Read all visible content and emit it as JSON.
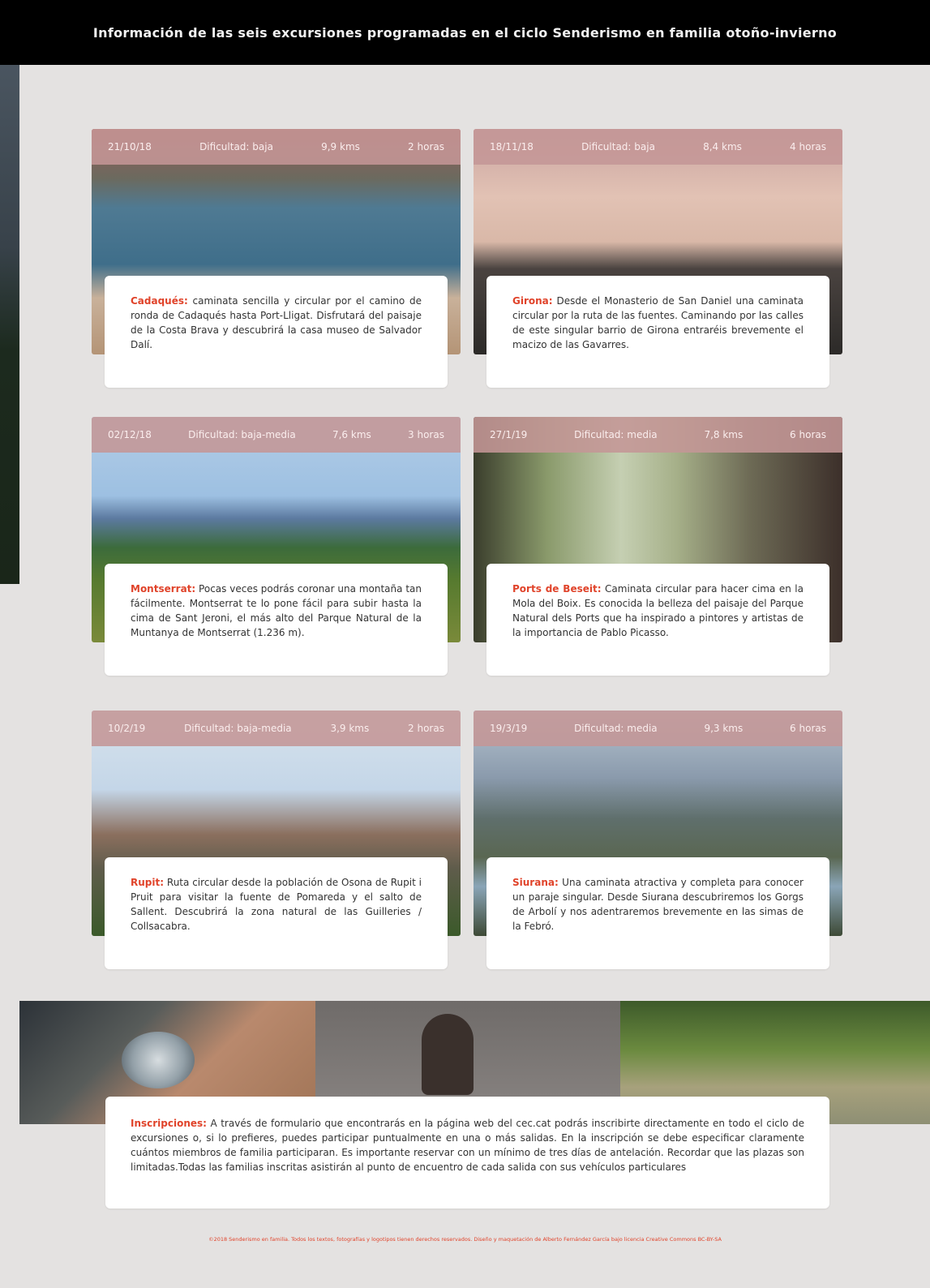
{
  "header": {
    "title": "Información de las seis excursiones programadas en el ciclo Senderismo en familia otoño-invierno"
  },
  "excursions": [
    {
      "date": "21/10/18",
      "difficulty": "Dificultad: baja",
      "distance": "9,9 kms",
      "duration": "2 horas",
      "place": "Cadaqués:",
      "description": " caminata sencilla y circular por el camino de ronda de Cadaqués hasta Port-Lligat. Disfrutará del paisaje de la Costa Brava y descubrirá la casa museo de Salvador Dalí."
    },
    {
      "date": "18/11/18",
      "difficulty": "Dificultad: baja",
      "distance": "8,4 kms",
      "duration": "4 horas",
      "place": "Girona:",
      "description": " Desde el Monasterio de San Daniel una caminata circular por la ruta de las fuentes. Caminando por las calles de este singular barrio de Girona entraréis brevemente el macizo de las Gavarres."
    },
    {
      "date": "02/12/18",
      "difficulty": "Dificultad: baja-media",
      "distance": "7,6 kms",
      "duration": "3 horas",
      "place": "Montserrat:",
      "description": " Pocas veces podrás coronar una montaña tan fácilmente. Montserrat te lo pone fácil para subir hasta la cima de Sant Jeroni, el más alto del Parque Natural de la Muntanya de Montserrat (1.236 m)."
    },
    {
      "date": "27/1/19",
      "difficulty": "Dificultad: media",
      "distance": "7,8 kms",
      "duration": "6 horas",
      "place": "Ports de Beseit:",
      "description": " Caminata circular para hacer cima en la Mola del Boix. Es conocida la belleza del paisaje del Parque Natural dels Ports que ha inspirado a pintores y artistas de la importancia de Pablo Picasso."
    },
    {
      "date": "10/2/19",
      "difficulty": "Dificultad: baja-media",
      "distance": "3,9 kms",
      "duration": "2 horas",
      "place": "Rupit:",
      "description": " Ruta circular desde la población de Osona de Rupit i Pruit para visitar la fuente de Pomareda y el salto de Sallent. Descubrirá la zona natural de las Guilleries / Collsacabra."
    },
    {
      "date": "19/3/19",
      "difficulty": "Dificultad: media",
      "distance": "9,3 kms",
      "duration": "6 horas",
      "place": "Siurana:",
      "description": " Una caminata atractiva y completa para conocer un paraje singular. Desde Siurana descubriremos los Gorgs de Arbolí y nos adentraremos brevemente en las simas de la Febró."
    }
  ],
  "registration": {
    "label": "Inscripciones:",
    "text": " A través de formulario que encontrarás en la página web del cec.cat podrás inscribirte directamente en todo el ciclo de excursiones o, si lo prefieres, puedes participar puntualmente en una o más salidas. En la inscripción se debe especificar claramente cuántos miembros de familia participaran. Es importante reservar con un mínimo de tres días de antelación. Recordar que las plazas son limitadas.Todas las familias inscritas asistirán al punto de encuentro de cada salida con sus vehículos particulares"
  },
  "footer": {
    "text": "©2018 Senderismo en familia. Todos los textos, fotografías y logotipos tienen derechos reservados. Diseño y maquetación de Alberto Fernández García bajo licencia Creative Commons BC-BY-SA"
  }
}
